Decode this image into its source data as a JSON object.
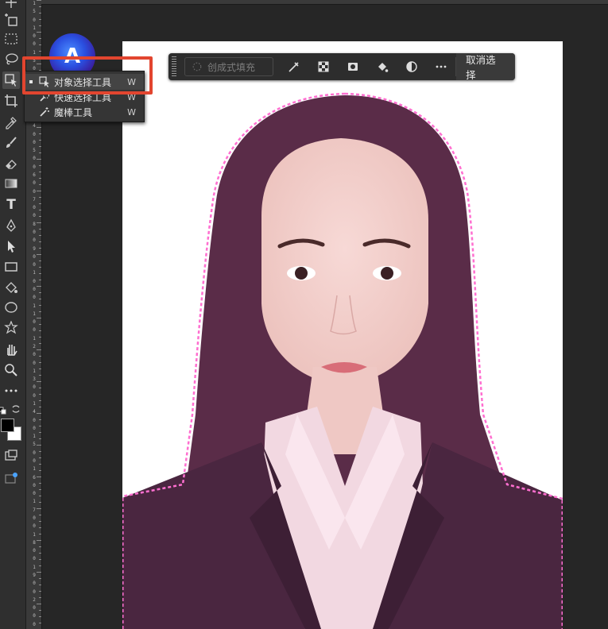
{
  "toolbar": {
    "tools": [
      {
        "name": "move-icon"
      },
      {
        "name": "artboard-icon"
      },
      {
        "name": "marquee-icon"
      },
      {
        "name": "lasso-icon"
      },
      {
        "name": "object-selection-icon",
        "active": true
      },
      {
        "name": "crop-icon"
      },
      {
        "name": "eyedropper-icon"
      },
      {
        "name": "brush-icon"
      },
      {
        "name": "eraser-icon"
      },
      {
        "name": "gradient-icon"
      },
      {
        "name": "type-icon"
      },
      {
        "name": "pen-icon"
      },
      {
        "name": "path-selection-icon"
      },
      {
        "name": "rectangle-icon"
      },
      {
        "name": "paint-bucket-icon"
      },
      {
        "name": "ellipse-icon"
      },
      {
        "name": "puppet-warp-icon"
      },
      {
        "name": "hand-icon"
      },
      {
        "name": "zoom-icon"
      },
      {
        "name": "more-icon"
      }
    ],
    "type_tool_glyph": "T",
    "foreground_color": "#000000",
    "background_color": "#ffffff"
  },
  "ruler": {
    "labels": [
      "1",
      "5",
      "0",
      "1",
      "0",
      "0",
      "1",
      "5",
      "0",
      "2",
      "0",
      "0",
      "3",
      "0",
      "0",
      "4",
      "0",
      "0",
      "5",
      "0",
      "0",
      "6",
      "0",
      "0",
      "7",
      "0",
      "0",
      "8",
      "0",
      "0",
      "9",
      "0",
      "0",
      "1",
      "0",
      "0",
      "0",
      "1",
      "1",
      "0",
      "0",
      "1",
      "2",
      "0",
      "0",
      "1",
      "3",
      "0",
      "0",
      "1",
      "4",
      "0",
      "0",
      "1",
      "5",
      "0",
      "0",
      "1",
      "6",
      "0",
      "0",
      "1",
      "7",
      "0",
      "0",
      "1",
      "8",
      "0",
      "0",
      "1",
      "9",
      "0",
      "0",
      "2",
      "0",
      "0",
      "0"
    ]
  },
  "app_logo": {
    "letter": "A"
  },
  "flyout": {
    "items": [
      {
        "label": "对象选择工具",
        "shortcut": "W",
        "icon": "object-selection-icon",
        "active": true
      },
      {
        "label": "快速选择工具",
        "shortcut": "W",
        "icon": "quick-selection-icon",
        "active": false
      },
      {
        "label": "魔棒工具",
        "shortcut": "W",
        "icon": "magic-wand-icon",
        "active": false
      }
    ]
  },
  "context_bar": {
    "generative_fill_label": "创成式填充",
    "icons": [
      "select-subject-icon",
      "checker-mask-icon",
      "mask-icon",
      "fill-icon",
      "adjust-icon",
      "more-options-icon"
    ],
    "deselect_label": "取消选择"
  },
  "colors": {
    "accent_highlight": "#e2452f",
    "selection_overlay": "#8a2a6e"
  }
}
